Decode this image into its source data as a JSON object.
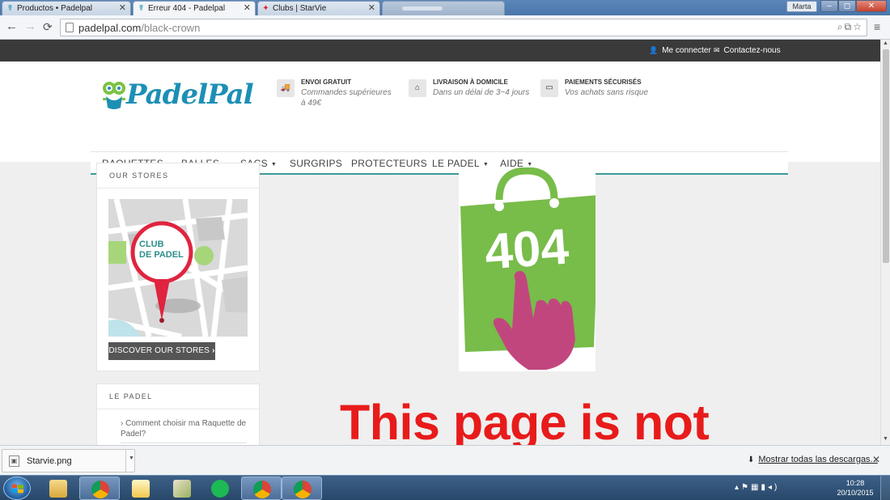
{
  "browser": {
    "tabs": [
      {
        "label": "Productos • Padelpal",
        "state": "inactive"
      },
      {
        "label": "Erreur 404 - Padelpal",
        "state": "active"
      },
      {
        "label": "Clubs | StarVie",
        "state": "inactive"
      }
    ],
    "user": "Marta",
    "url_host": "padelpal.com",
    "url_path": "/black-crown"
  },
  "site": {
    "topbar": {
      "login": "Me connecter",
      "contact": "Contactez-nous"
    },
    "logo": "PadelPal",
    "features": [
      {
        "icon": "truck-icon",
        "title": "ENVOI GRATUIT",
        "subtitle": "Commandes supérieures à 49€"
      },
      {
        "icon": "home-icon",
        "title": "LIVRAISON À DOMICILE",
        "subtitle": "Dans un délai de 3~4 jours"
      },
      {
        "icon": "credit-card-icon",
        "title": "PAIEMENTS SÉCURISÉS",
        "subtitle": "Vos achats sans risque"
      }
    ],
    "nav": [
      {
        "label": "RAQUETTES",
        "dropdown": true
      },
      {
        "label": "BALLES",
        "dropdown": true
      },
      {
        "label": "SACS",
        "dropdown": true
      },
      {
        "label": "SURGRIPS",
        "dropdown": false
      },
      {
        "label": "PROTECTEURS",
        "dropdown": false
      },
      {
        "label": "LE PADEL",
        "dropdown": true
      },
      {
        "label": "AIDE",
        "dropdown": true
      }
    ],
    "sidebar": {
      "stores_title": "OUR STORES",
      "map_label_line1": "CLUB",
      "map_label_line2": "DE PADEL",
      "stores_button": "DISCOVER OUR STORES",
      "padel_title": "LE PADEL",
      "padel_link": "› Comment choisir ma Raquette de Padel?"
    },
    "error": {
      "code": "404",
      "headline": "This page is not"
    },
    "colors": {
      "brand_blue": "#1d8fb5",
      "brand_green": "#7cc242",
      "nav_underline": "#3a9a9a",
      "error_red": "#e81b1b",
      "bag_green": "#78bc4a",
      "hand_pink": "#c2467e"
    }
  },
  "downloads": {
    "file": "Starvie.png",
    "show_all": "Mostrar todas las descargas..."
  },
  "taskbar": {
    "time": "10:28",
    "date": "20/10/2015"
  }
}
